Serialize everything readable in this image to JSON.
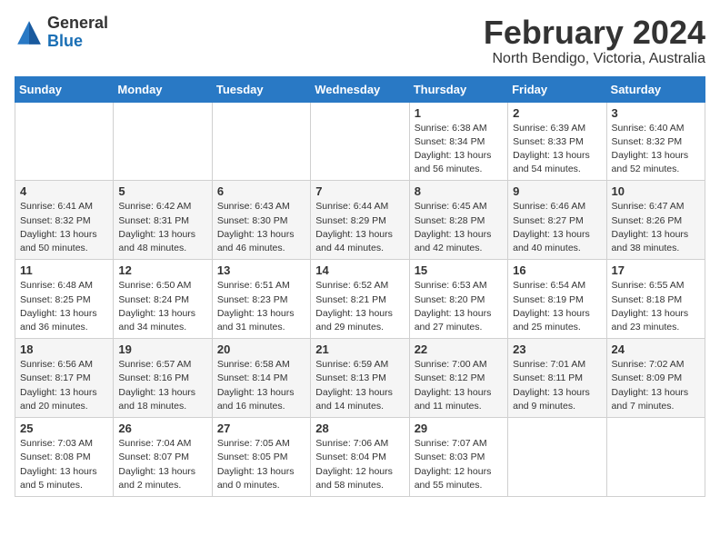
{
  "header": {
    "logo_general": "General",
    "logo_blue": "Blue",
    "month_year": "February 2024",
    "location": "North Bendigo, Victoria, Australia"
  },
  "weekdays": [
    "Sunday",
    "Monday",
    "Tuesday",
    "Wednesday",
    "Thursday",
    "Friday",
    "Saturday"
  ],
  "weeks": [
    [
      {
        "day": "",
        "info": ""
      },
      {
        "day": "",
        "info": ""
      },
      {
        "day": "",
        "info": ""
      },
      {
        "day": "",
        "info": ""
      },
      {
        "day": "1",
        "info": "Sunrise: 6:38 AM\nSunset: 8:34 PM\nDaylight: 13 hours\nand 56 minutes."
      },
      {
        "day": "2",
        "info": "Sunrise: 6:39 AM\nSunset: 8:33 PM\nDaylight: 13 hours\nand 54 minutes."
      },
      {
        "day": "3",
        "info": "Sunrise: 6:40 AM\nSunset: 8:32 PM\nDaylight: 13 hours\nand 52 minutes."
      }
    ],
    [
      {
        "day": "4",
        "info": "Sunrise: 6:41 AM\nSunset: 8:32 PM\nDaylight: 13 hours\nand 50 minutes."
      },
      {
        "day": "5",
        "info": "Sunrise: 6:42 AM\nSunset: 8:31 PM\nDaylight: 13 hours\nand 48 minutes."
      },
      {
        "day": "6",
        "info": "Sunrise: 6:43 AM\nSunset: 8:30 PM\nDaylight: 13 hours\nand 46 minutes."
      },
      {
        "day": "7",
        "info": "Sunrise: 6:44 AM\nSunset: 8:29 PM\nDaylight: 13 hours\nand 44 minutes."
      },
      {
        "day": "8",
        "info": "Sunrise: 6:45 AM\nSunset: 8:28 PM\nDaylight: 13 hours\nand 42 minutes."
      },
      {
        "day": "9",
        "info": "Sunrise: 6:46 AM\nSunset: 8:27 PM\nDaylight: 13 hours\nand 40 minutes."
      },
      {
        "day": "10",
        "info": "Sunrise: 6:47 AM\nSunset: 8:26 PM\nDaylight: 13 hours\nand 38 minutes."
      }
    ],
    [
      {
        "day": "11",
        "info": "Sunrise: 6:48 AM\nSunset: 8:25 PM\nDaylight: 13 hours\nand 36 minutes."
      },
      {
        "day": "12",
        "info": "Sunrise: 6:50 AM\nSunset: 8:24 PM\nDaylight: 13 hours\nand 34 minutes."
      },
      {
        "day": "13",
        "info": "Sunrise: 6:51 AM\nSunset: 8:23 PM\nDaylight: 13 hours\nand 31 minutes."
      },
      {
        "day": "14",
        "info": "Sunrise: 6:52 AM\nSunset: 8:21 PM\nDaylight: 13 hours\nand 29 minutes."
      },
      {
        "day": "15",
        "info": "Sunrise: 6:53 AM\nSunset: 8:20 PM\nDaylight: 13 hours\nand 27 minutes."
      },
      {
        "day": "16",
        "info": "Sunrise: 6:54 AM\nSunset: 8:19 PM\nDaylight: 13 hours\nand 25 minutes."
      },
      {
        "day": "17",
        "info": "Sunrise: 6:55 AM\nSunset: 8:18 PM\nDaylight: 13 hours\nand 23 minutes."
      }
    ],
    [
      {
        "day": "18",
        "info": "Sunrise: 6:56 AM\nSunset: 8:17 PM\nDaylight: 13 hours\nand 20 minutes."
      },
      {
        "day": "19",
        "info": "Sunrise: 6:57 AM\nSunset: 8:16 PM\nDaylight: 13 hours\nand 18 minutes."
      },
      {
        "day": "20",
        "info": "Sunrise: 6:58 AM\nSunset: 8:14 PM\nDaylight: 13 hours\nand 16 minutes."
      },
      {
        "day": "21",
        "info": "Sunrise: 6:59 AM\nSunset: 8:13 PM\nDaylight: 13 hours\nand 14 minutes."
      },
      {
        "day": "22",
        "info": "Sunrise: 7:00 AM\nSunset: 8:12 PM\nDaylight: 13 hours\nand 11 minutes."
      },
      {
        "day": "23",
        "info": "Sunrise: 7:01 AM\nSunset: 8:11 PM\nDaylight: 13 hours\nand 9 minutes."
      },
      {
        "day": "24",
        "info": "Sunrise: 7:02 AM\nSunset: 8:09 PM\nDaylight: 13 hours\nand 7 minutes."
      }
    ],
    [
      {
        "day": "25",
        "info": "Sunrise: 7:03 AM\nSunset: 8:08 PM\nDaylight: 13 hours\nand 5 minutes."
      },
      {
        "day": "26",
        "info": "Sunrise: 7:04 AM\nSunset: 8:07 PM\nDaylight: 13 hours\nand 2 minutes."
      },
      {
        "day": "27",
        "info": "Sunrise: 7:05 AM\nSunset: 8:05 PM\nDaylight: 13 hours\nand 0 minutes."
      },
      {
        "day": "28",
        "info": "Sunrise: 7:06 AM\nSunset: 8:04 PM\nDaylight: 12 hours\nand 58 minutes."
      },
      {
        "day": "29",
        "info": "Sunrise: 7:07 AM\nSunset: 8:03 PM\nDaylight: 12 hours\nand 55 minutes."
      },
      {
        "day": "",
        "info": ""
      },
      {
        "day": "",
        "info": ""
      }
    ]
  ]
}
